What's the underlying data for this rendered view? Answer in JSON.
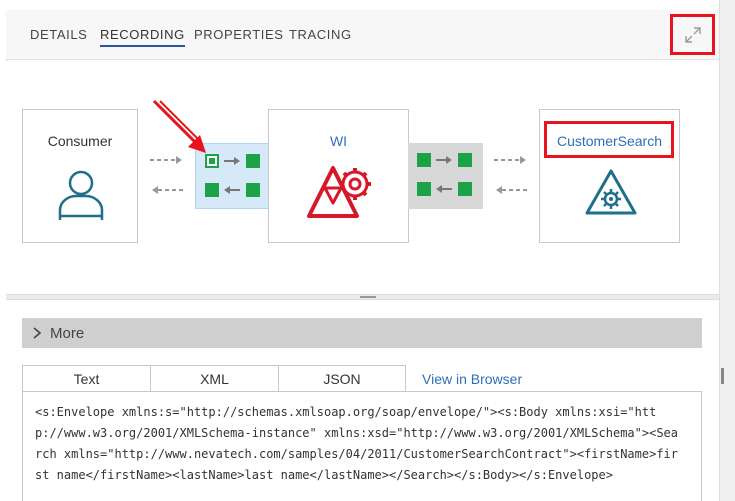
{
  "tabs": [
    {
      "label": "DETAILS",
      "active": false
    },
    {
      "label": "RECORDING",
      "active": true
    },
    {
      "label": "PROPERTIES",
      "active": false
    },
    {
      "label": "TRACING",
      "active": false
    }
  ],
  "diagram": {
    "consumer": {
      "label": "Consumer",
      "icon": "user-icon"
    },
    "wi": {
      "label": "WI",
      "icon": "alert-gear-icon"
    },
    "service": {
      "label": "CustomerSearch",
      "icon": "service-gear-icon"
    }
  },
  "more": {
    "label": "More"
  },
  "subtabs": [
    {
      "label": "Text",
      "active": true
    },
    {
      "label": "XML",
      "active": false
    },
    {
      "label": "JSON",
      "active": false
    }
  ],
  "view_in_browser": "View in Browser",
  "message_text": "<s:Envelope xmlns:s=\"http://schemas.xmlsoap.org/soap/envelope/\"><s:Body xmlns:xsi=\"http://www.w3.org/2001/XMLSchema-instance\" xmlns:xsd=\"http://www.w3.org/2001/XMLSchema\"><Search xmlns=\"http://www.nevatech.com/samples/04/2011/CustomerSearchContract\"><firstName>first name</firstName><lastName>last name</lastName></Search></s:Body></s:Envelope>",
  "colors": {
    "accent": "#2b5797",
    "link": "#2e6fb7",
    "green": "#1ca347",
    "highlight": "#e8141d",
    "error": "#d7182a",
    "teal": "#1f6f8b"
  }
}
